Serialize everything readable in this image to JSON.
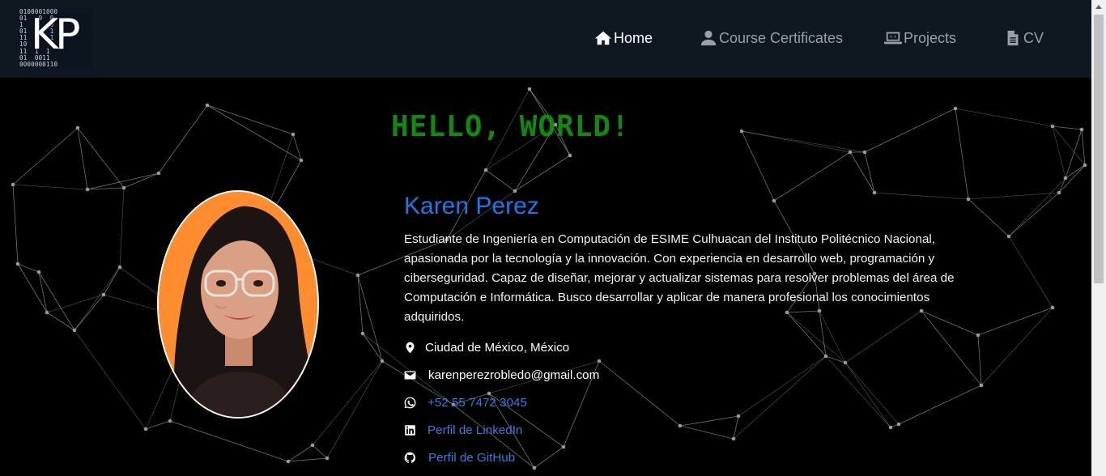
{
  "header": {
    "logo": {
      "bits": [
        "0100001000",
        "01   9  0",
        "1       0",
        "01      1",
        "11      1",
        "10      0",
        "11  1  1",
        "01  0011",
        "0000000110"
      ],
      "initials": "KP"
    },
    "nav": [
      {
        "label": "Home",
        "icon": "home-icon",
        "active": true
      },
      {
        "label": "Course Certificates",
        "icon": "user-icon",
        "active": false
      },
      {
        "label": "Projects",
        "icon": "laptop-code-icon",
        "active": false
      },
      {
        "label": "CV",
        "icon": "file-icon",
        "active": false
      }
    ]
  },
  "hero": {
    "greeting": "HELLO, WORLD!",
    "name": "Karen Perez",
    "bio": "Estudiante de Ingeniería en Computación de ESIME Culhuacan del Instituto Politécnico Nacional, apasionada por la tecnología y la innovación. Con experiencia en desarrollo web, programación y ciberseguridad. Capaz de diseñar, mejorar y actualizar sistemas para resolver problemas del área de Computación e Informática. Busco desarrollar y aplicar de manera profesional los conocimientos adquiridos.",
    "contacts": [
      {
        "label": "Ciudad de México, México",
        "icon": "map-marker-icon",
        "link": false
      },
      {
        "label": "karenperezrobledo@gmail.com",
        "icon": "envelope-icon",
        "link": false
      },
      {
        "label": "+52 55 7472 3045",
        "icon": "whatsapp-icon",
        "link": true
      },
      {
        "label": "Perfil de LinkedIn",
        "icon": "linkedin-icon",
        "link": true
      },
      {
        "label": "Perfil de GitHub",
        "icon": "github-icon",
        "link": true
      }
    ]
  },
  "colors": {
    "navbar_bg": "#0f1721",
    "nav_active": "#ffffff",
    "nav_inactive": "#9aa0a6",
    "greeting": "#0f8a0f",
    "name": "#1a7ae8",
    "link": "#2d7fe0",
    "photo_bg": "#ff8c2e"
  }
}
